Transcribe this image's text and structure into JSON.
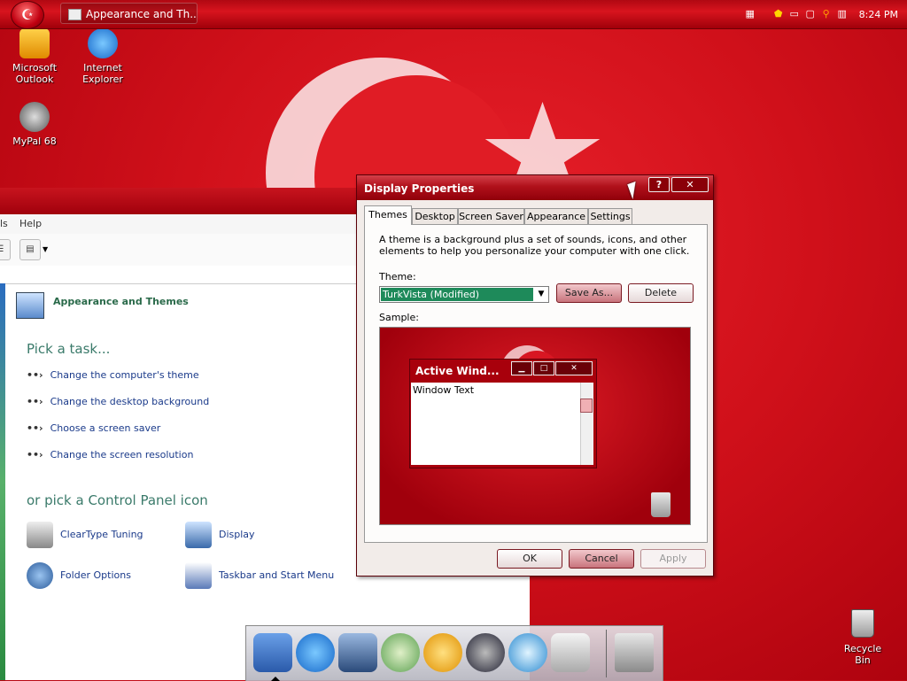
{
  "taskbar": {
    "start_glyph": "☪",
    "task_button": "Appearance and Th...",
    "clock": "8:24 PM",
    "tray_icons": [
      "keyboard-icon",
      "shield-icon",
      "battery-icon",
      "network-icon",
      "search-icon",
      "media-icon"
    ]
  },
  "desktop_icons": [
    {
      "label_line1": "Microsoft",
      "label_line2": "Outlook"
    },
    {
      "label_line1": "Internet",
      "label_line2": "Explorer"
    },
    {
      "label_line1": "MyPal 68",
      "label_line2": ""
    }
  ],
  "recycle_bin": {
    "label": "Recycle Bin"
  },
  "control_panel": {
    "menu": {
      "item1": "ls",
      "help": "Help"
    },
    "heading": "Appearance and Themes",
    "pick_task": "Pick a task...",
    "tasks": [
      "Change the computer's theme",
      "Change the desktop background",
      "Choose a screen saver",
      "Change the screen resolution"
    ],
    "pick_icon": "or pick a Control Panel icon",
    "icons": [
      "ClearType Tuning",
      "Display",
      "Folder Options",
      "Taskbar and Start Menu"
    ]
  },
  "dialog": {
    "title": "Display Properties",
    "help_btn": "?",
    "close_btn": "✕",
    "tabs": [
      "Themes",
      "Desktop",
      "Screen Saver",
      "Appearance",
      "Settings"
    ],
    "description": "A theme is a background plus a set of sounds, icons, and other elements to help you personalize your computer with one click.",
    "theme_label": "Theme:",
    "theme_value": "TurkVista (Modified)",
    "save_as": "Save As...",
    "delete": "Delete",
    "sample_label": "Sample:",
    "sample_window_title": "Active Wind...",
    "sample_window_text": "Window Text",
    "ok": "OK",
    "cancel": "Cancel",
    "apply": "Apply"
  },
  "colors": {
    "accent": "#d0101a",
    "theme_selection": "#1e8a5a"
  }
}
